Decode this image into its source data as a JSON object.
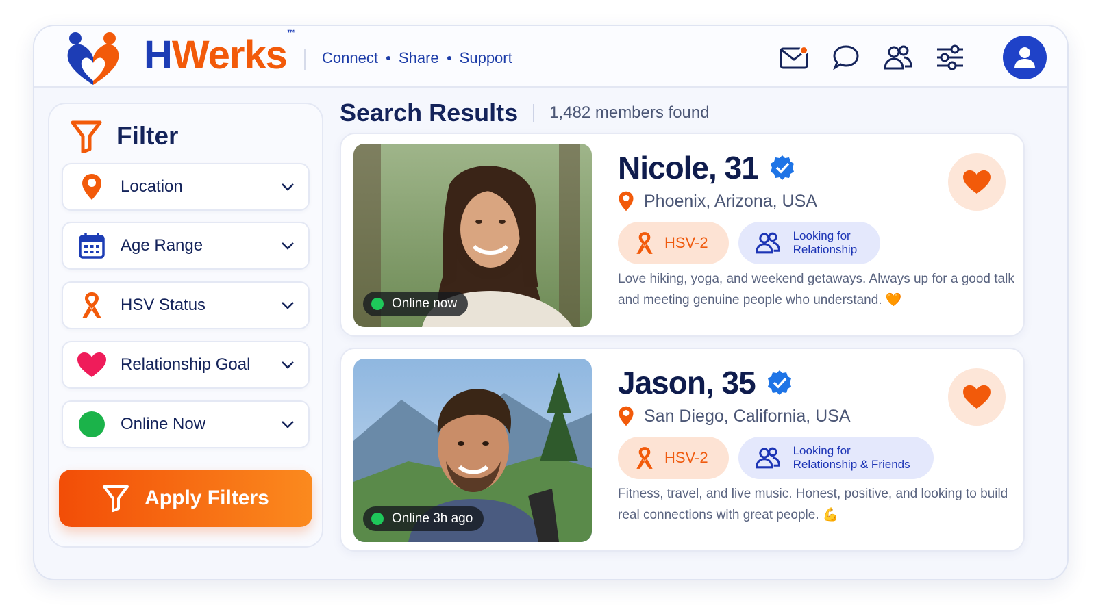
{
  "brand": {
    "name_first": "H",
    "name_rest": "Werks",
    "trademark": "™",
    "tagline": [
      "Connect",
      "Share",
      "Support"
    ]
  },
  "nav": {
    "icons": [
      "mail-icon",
      "chat-icon",
      "users-icon",
      "settings-sliders-icon",
      "profile-icon"
    ],
    "mail_has_notification": true
  },
  "filter": {
    "title": "Filter",
    "items": [
      {
        "label": "Location",
        "icon": "location-pin-icon"
      },
      {
        "label": "Age Range",
        "icon": "calendar-icon"
      },
      {
        "label": "HSV Status",
        "icon": "awareness-ribbon-icon"
      },
      {
        "label": "Relationship Goal",
        "icon": "heart-icon"
      },
      {
        "label": "Online Now",
        "icon": "online-dot-icon"
      }
    ],
    "apply_label": "Apply Filters"
  },
  "results": {
    "title": "Search Results",
    "count_text": "1,482 members found",
    "profiles": [
      {
        "name": "Nicole, 31",
        "verified": true,
        "location": "Phoenix, Arizona, USA",
        "status": "Online now",
        "hsv_tag": "HSV-2",
        "goal_line1": "Looking for",
        "goal_line2": "Relationship",
        "bio": "Love hiking, yoga, and weekend getaways. Always up for a good talk and meeting genuine people who understand.",
        "bio_emoji": "🧡"
      },
      {
        "name": "Jason, 35",
        "verified": true,
        "location": "San Diego, California, USA",
        "status": "Online 3h ago",
        "hsv_tag": "HSV-2",
        "goal_line1": "Looking for",
        "goal_line2": "Relationship & Friends",
        "bio": "Fitness, travel, and live music. Honest, positive, and looking to build real connections with great people.",
        "bio_emoji": "💪"
      }
    ]
  },
  "colors": {
    "brand_blue": "#1d3db5",
    "brand_orange": "#f25a0a",
    "online_green": "#1ec85a",
    "background": "#f5f7fd"
  }
}
